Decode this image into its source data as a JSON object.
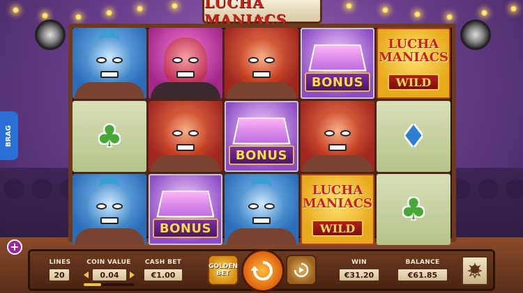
{
  "title": "LUCHA MANIACS",
  "side_tab": {
    "label": "BRAG"
  },
  "plus_button": {
    "glyph": "+"
  },
  "reels": [
    [
      {
        "symbol": "blue-wrestler"
      },
      {
        "symbol": "club"
      },
      {
        "symbol": "blue-wrestler"
      }
    ],
    [
      {
        "symbol": "pink-wrestler"
      },
      {
        "symbol": "red-wrestler"
      },
      {
        "symbol": "bonus",
        "label": "BONUS"
      }
    ],
    [
      {
        "symbol": "red-wrestler"
      },
      {
        "symbol": "bonus",
        "label": "BONUS"
      },
      {
        "symbol": "blue-wrestler"
      }
    ],
    [
      {
        "symbol": "bonus",
        "label": "BONUS"
      },
      {
        "symbol": "red-wrestler"
      },
      {
        "symbol": "wild",
        "label": "LUCHA\nMANIACS",
        "banner": "WILD"
      }
    ],
    [
      {
        "symbol": "wild",
        "label": "LUCHA\nMANIACS",
        "banner": "WILD"
      },
      {
        "symbol": "diamond"
      },
      {
        "symbol": "club"
      }
    ]
  ],
  "controls": {
    "lines": {
      "label": "LINES",
      "value": "20"
    },
    "coin_value": {
      "label": "COIN VALUE",
      "value": "0.04",
      "slider_fraction": 0.35
    },
    "cash_bet": {
      "label": "CASH BET",
      "value": "€1.00"
    },
    "golden_bet": {
      "label": "GOLDEN\nBET"
    },
    "spin": {
      "icon": "spin-icon"
    },
    "autoplay": {
      "icon": "autoplay-icon"
    },
    "win": {
      "label": "WIN",
      "value": "€31.20"
    },
    "balance": {
      "label": "BALANCE",
      "value": "€61.85"
    },
    "menu": {
      "icon": "menu-emblem-icon"
    }
  },
  "colors": {
    "accent_gold": "#f0c14b",
    "brag_blue": "#2a6fd6",
    "bonus_purple": "#7b2fa0",
    "wild_red": "#c8221b"
  }
}
